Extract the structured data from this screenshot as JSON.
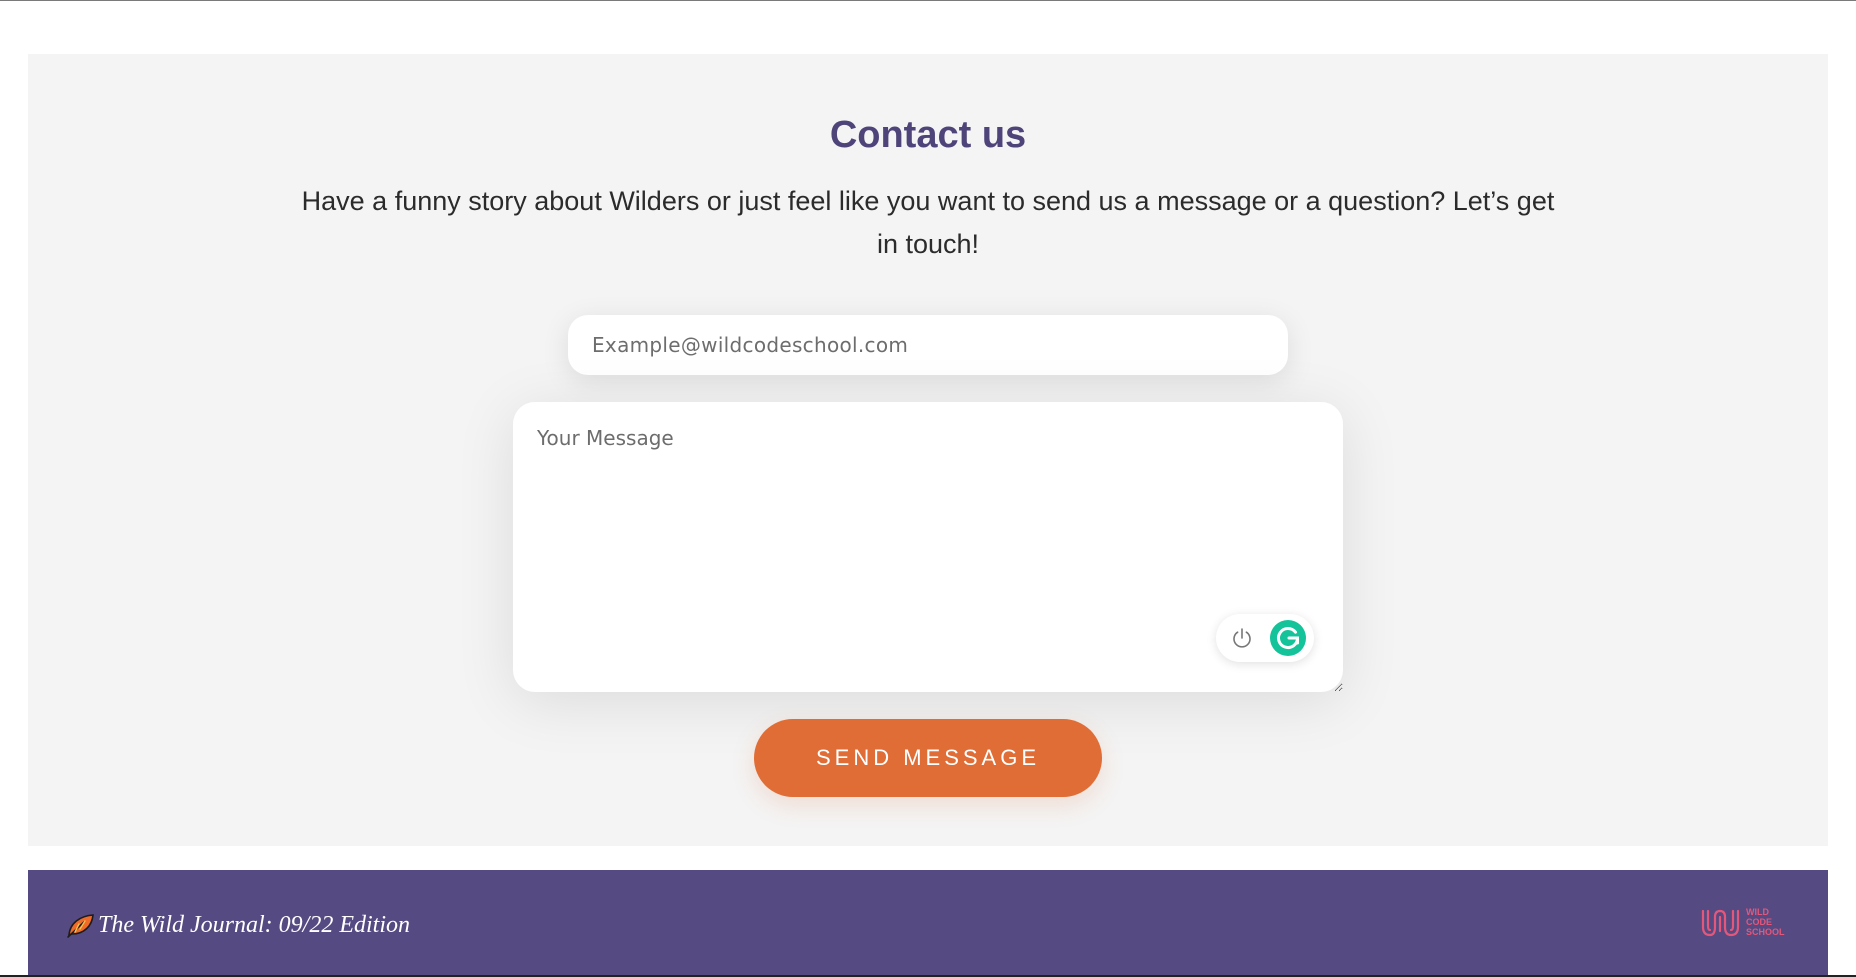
{
  "contact": {
    "title": "Contact us",
    "intro": "Have a funny story about Wilders or just feel like you want to send us a message or a question? Let’s get in touch!",
    "email_placeholder": "Example@wildcodeschool.com",
    "message_placeholder": "Your Message",
    "send_label": "SEND MESSAGE"
  },
  "footer": {
    "journal_title": "The Wild Journal: 09/22 Edition",
    "logo_text": "WILD\nCODE\nSCHOOL"
  },
  "icons": {
    "grammarly_power": "power-icon",
    "grammarly": "grammarly-icon",
    "journal": "leaf-icon",
    "logo": "wild-code-school-logo"
  },
  "colors": {
    "title": "#4f4479",
    "button": "#e06d36",
    "footer": "#554a81",
    "logo": "#e4577a",
    "grammarly": "#15c39a"
  }
}
